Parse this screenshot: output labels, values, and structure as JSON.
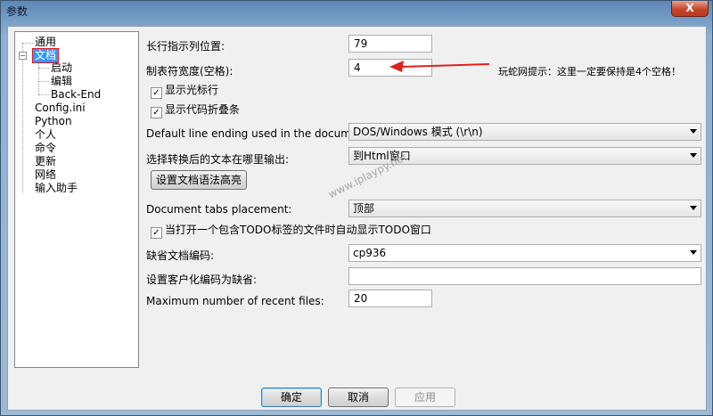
{
  "window": {
    "title": "参数",
    "close_label": "X"
  },
  "tree": {
    "items": [
      {
        "label": "通用"
      },
      {
        "label": "文档"
      },
      {
        "label": "启动"
      },
      {
        "label": "编辑"
      },
      {
        "label": "Back-End"
      },
      {
        "label": "Config.ini"
      },
      {
        "label": "Python"
      },
      {
        "label": "个人"
      },
      {
        "label": "命令"
      },
      {
        "label": "更新"
      },
      {
        "label": "网络"
      },
      {
        "label": "输入助手"
      }
    ],
    "toggle_symbol": "−"
  },
  "form": {
    "long_line_label": "长行指示列位置:",
    "long_line_value": "79",
    "tab_width_label": "制表符宽度(空格):",
    "tab_width_value": "4",
    "show_caret_line_label": "显示光标行",
    "show_caret_line_checked": true,
    "show_code_folding_label": "显示代码折叠条",
    "show_code_folding_checked": true,
    "line_ending_label": "Default line ending used in the document:",
    "line_ending_value": "DOS/Windows 模式 (\\r\\n)",
    "output_target_label": "选择转换后的文本在哪里输出:",
    "output_target_value": "到Html窗口",
    "syntax_button_label": "设置文档语法高亮",
    "tabs_placement_label": "Document tabs placement:",
    "tabs_placement_value": "顶部",
    "todo_label": "当打开一个包含TODO标签的文件时自动显示TODO窗口",
    "todo_checked": true,
    "default_encoding_label": "缺省文档编码:",
    "default_encoding_value": "cp936",
    "custom_encoding_label": "设置客户化编码为缺省:",
    "custom_encoding_value": "",
    "recent_files_label": "Maximum number of recent files:",
    "recent_files_value": "20"
  },
  "annotation": {
    "text": "玩蛇网提示：这里一定要保持是4个空格！",
    "arrow_color": "#e0201b"
  },
  "watermark": {
    "text": "www.iplaypy.net"
  },
  "buttons": {
    "ok": "确定",
    "cancel": "取消",
    "apply": "应用"
  },
  "checkmark": "✓"
}
